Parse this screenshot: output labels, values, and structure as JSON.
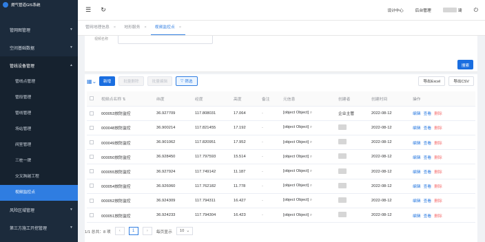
{
  "app": {
    "title": "燃气管道GIS系统"
  },
  "sidebar": {
    "items": [
      {
        "label": "管网图管理"
      },
      {
        "label": "空间基础数据"
      },
      {
        "label": "管线设备管理"
      }
    ],
    "subitems": [
      {
        "label": "管线点管理"
      },
      {
        "label": "管段管理"
      },
      {
        "label": "管线管理"
      },
      {
        "label": "场站管理"
      },
      {
        "label": "阀室管理"
      },
      {
        "label": "三桩一牌"
      },
      {
        "label": "交叉跨越工程"
      },
      {
        "label": "视频监控点"
      }
    ],
    "items_after": [
      {
        "label": "风险区域管理"
      },
      {
        "label": "第三方施工开挖管理"
      }
    ]
  },
  "topbar": {
    "design_center": "设计中心",
    "admin": "后台管理",
    "user_suffix": "琦"
  },
  "tabs": [
    {
      "label": "管网地理信息"
    },
    {
      "label": "地形服务"
    },
    {
      "label": "视频监控点"
    }
  ],
  "filter": {
    "label": "视频名称",
    "search_label": "搜索"
  },
  "toolbar": {
    "add": "新增",
    "batch_delete": "批量删除",
    "batch_edit": "批量编辑",
    "filter": "筛选",
    "export_excel": "导出Excel",
    "export_csv": "导出CSV"
  },
  "table": {
    "headers": [
      "视频点名称",
      "纬度",
      "经度",
      "高度",
      "备注",
      "元信息",
      "创建者",
      "创建时间",
      "操作"
    ],
    "rows": [
      {
        "name": "000053放防监控",
        "lat": "36.927709",
        "lng": "117.808031",
        "height": "17.064",
        "note": "-",
        "meta": "[object Object]",
        "creator": "企业主管",
        "time": "2022-08-12"
      },
      {
        "name": "000048放防监控",
        "lat": "36.900214",
        "lng": "117.821455",
        "height": "17.192",
        "note": "-",
        "meta": "[object Object]",
        "creator": "",
        "time": "2022-08-12"
      },
      {
        "name": "000049放防监控",
        "lat": "36.901062",
        "lng": "117.820951",
        "height": "17.952",
        "note": "-",
        "meta": "[object Object]",
        "creator": "",
        "time": "2022-08-12"
      },
      {
        "name": "000050放防监控",
        "lat": "36.928450",
        "lng": "117.797593",
        "height": "15.514",
        "note": "-",
        "meta": "[object Object]",
        "creator": "",
        "time": "2022-08-12"
      },
      {
        "name": "000055放防监控",
        "lat": "36.927924",
        "lng": "117.749142",
        "height": "11.187",
        "note": "-",
        "meta": "[object Object]",
        "creator": "",
        "time": "2022-08-12"
      },
      {
        "name": "000054放防监控",
        "lat": "36.926060",
        "lng": "117.762182",
        "height": "11.778",
        "note": "-",
        "meta": "[object Object]",
        "creator": "",
        "time": "2022-08-12"
      },
      {
        "name": "000052放防监控",
        "lat": "36.924309",
        "lng": "117.794311",
        "height": "16.427",
        "note": "-",
        "meta": "[object Object]",
        "creator": "",
        "time": "2022-08-12"
      },
      {
        "name": "000051放防监控",
        "lat": "36.924233",
        "lng": "117.794304",
        "height": "16.423",
        "note": "-",
        "meta": "[object Object]",
        "creator": "",
        "time": "2022-08-12"
      }
    ],
    "actions": {
      "edit": "编辑",
      "view": "查看",
      "delete": "删除"
    }
  },
  "pager": {
    "summary": "1/1 总共：8 项",
    "page": "1",
    "page_size_label": "每页显示",
    "page_size": "10"
  }
}
